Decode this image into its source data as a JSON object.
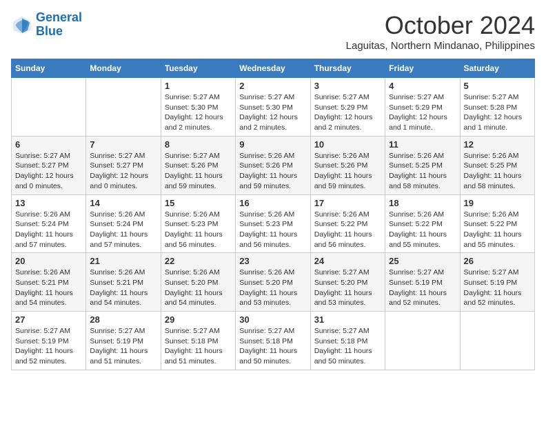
{
  "logo": {
    "line1": "General",
    "line2": "Blue"
  },
  "title": "October 2024",
  "subtitle": "Laguitas, Northern Mindanao, Philippines",
  "weekdays": [
    "Sunday",
    "Monday",
    "Tuesday",
    "Wednesday",
    "Thursday",
    "Friday",
    "Saturday"
  ],
  "weeks": [
    [
      {
        "day": "",
        "info": ""
      },
      {
        "day": "",
        "info": ""
      },
      {
        "day": "1",
        "info": "Sunrise: 5:27 AM\nSunset: 5:30 PM\nDaylight: 12 hours and 2 minutes."
      },
      {
        "day": "2",
        "info": "Sunrise: 5:27 AM\nSunset: 5:30 PM\nDaylight: 12 hours and 2 minutes."
      },
      {
        "day": "3",
        "info": "Sunrise: 5:27 AM\nSunset: 5:29 PM\nDaylight: 12 hours and 2 minutes."
      },
      {
        "day": "4",
        "info": "Sunrise: 5:27 AM\nSunset: 5:29 PM\nDaylight: 12 hours and 1 minute."
      },
      {
        "day": "5",
        "info": "Sunrise: 5:27 AM\nSunset: 5:28 PM\nDaylight: 12 hours and 1 minute."
      }
    ],
    [
      {
        "day": "6",
        "info": "Sunrise: 5:27 AM\nSunset: 5:27 PM\nDaylight: 12 hours and 0 minutes."
      },
      {
        "day": "7",
        "info": "Sunrise: 5:27 AM\nSunset: 5:27 PM\nDaylight: 12 hours and 0 minutes."
      },
      {
        "day": "8",
        "info": "Sunrise: 5:27 AM\nSunset: 5:26 PM\nDaylight: 11 hours and 59 minutes."
      },
      {
        "day": "9",
        "info": "Sunrise: 5:26 AM\nSunset: 5:26 PM\nDaylight: 11 hours and 59 minutes."
      },
      {
        "day": "10",
        "info": "Sunrise: 5:26 AM\nSunset: 5:26 PM\nDaylight: 11 hours and 59 minutes."
      },
      {
        "day": "11",
        "info": "Sunrise: 5:26 AM\nSunset: 5:25 PM\nDaylight: 11 hours and 58 minutes."
      },
      {
        "day": "12",
        "info": "Sunrise: 5:26 AM\nSunset: 5:25 PM\nDaylight: 11 hours and 58 minutes."
      }
    ],
    [
      {
        "day": "13",
        "info": "Sunrise: 5:26 AM\nSunset: 5:24 PM\nDaylight: 11 hours and 57 minutes."
      },
      {
        "day": "14",
        "info": "Sunrise: 5:26 AM\nSunset: 5:24 PM\nDaylight: 11 hours and 57 minutes."
      },
      {
        "day": "15",
        "info": "Sunrise: 5:26 AM\nSunset: 5:23 PM\nDaylight: 11 hours and 56 minutes."
      },
      {
        "day": "16",
        "info": "Sunrise: 5:26 AM\nSunset: 5:23 PM\nDaylight: 11 hours and 56 minutes."
      },
      {
        "day": "17",
        "info": "Sunrise: 5:26 AM\nSunset: 5:22 PM\nDaylight: 11 hours and 56 minutes."
      },
      {
        "day": "18",
        "info": "Sunrise: 5:26 AM\nSunset: 5:22 PM\nDaylight: 11 hours and 55 minutes."
      },
      {
        "day": "19",
        "info": "Sunrise: 5:26 AM\nSunset: 5:22 PM\nDaylight: 11 hours and 55 minutes."
      }
    ],
    [
      {
        "day": "20",
        "info": "Sunrise: 5:26 AM\nSunset: 5:21 PM\nDaylight: 11 hours and 54 minutes."
      },
      {
        "day": "21",
        "info": "Sunrise: 5:26 AM\nSunset: 5:21 PM\nDaylight: 11 hours and 54 minutes."
      },
      {
        "day": "22",
        "info": "Sunrise: 5:26 AM\nSunset: 5:20 PM\nDaylight: 11 hours and 54 minutes."
      },
      {
        "day": "23",
        "info": "Sunrise: 5:26 AM\nSunset: 5:20 PM\nDaylight: 11 hours and 53 minutes."
      },
      {
        "day": "24",
        "info": "Sunrise: 5:27 AM\nSunset: 5:20 PM\nDaylight: 11 hours and 53 minutes."
      },
      {
        "day": "25",
        "info": "Sunrise: 5:27 AM\nSunset: 5:19 PM\nDaylight: 11 hours and 52 minutes."
      },
      {
        "day": "26",
        "info": "Sunrise: 5:27 AM\nSunset: 5:19 PM\nDaylight: 11 hours and 52 minutes."
      }
    ],
    [
      {
        "day": "27",
        "info": "Sunrise: 5:27 AM\nSunset: 5:19 PM\nDaylight: 11 hours and 52 minutes."
      },
      {
        "day": "28",
        "info": "Sunrise: 5:27 AM\nSunset: 5:19 PM\nDaylight: 11 hours and 51 minutes."
      },
      {
        "day": "29",
        "info": "Sunrise: 5:27 AM\nSunset: 5:18 PM\nDaylight: 11 hours and 51 minutes."
      },
      {
        "day": "30",
        "info": "Sunrise: 5:27 AM\nSunset: 5:18 PM\nDaylight: 11 hours and 50 minutes."
      },
      {
        "day": "31",
        "info": "Sunrise: 5:27 AM\nSunset: 5:18 PM\nDaylight: 11 hours and 50 minutes."
      },
      {
        "day": "",
        "info": ""
      },
      {
        "day": "",
        "info": ""
      }
    ]
  ]
}
